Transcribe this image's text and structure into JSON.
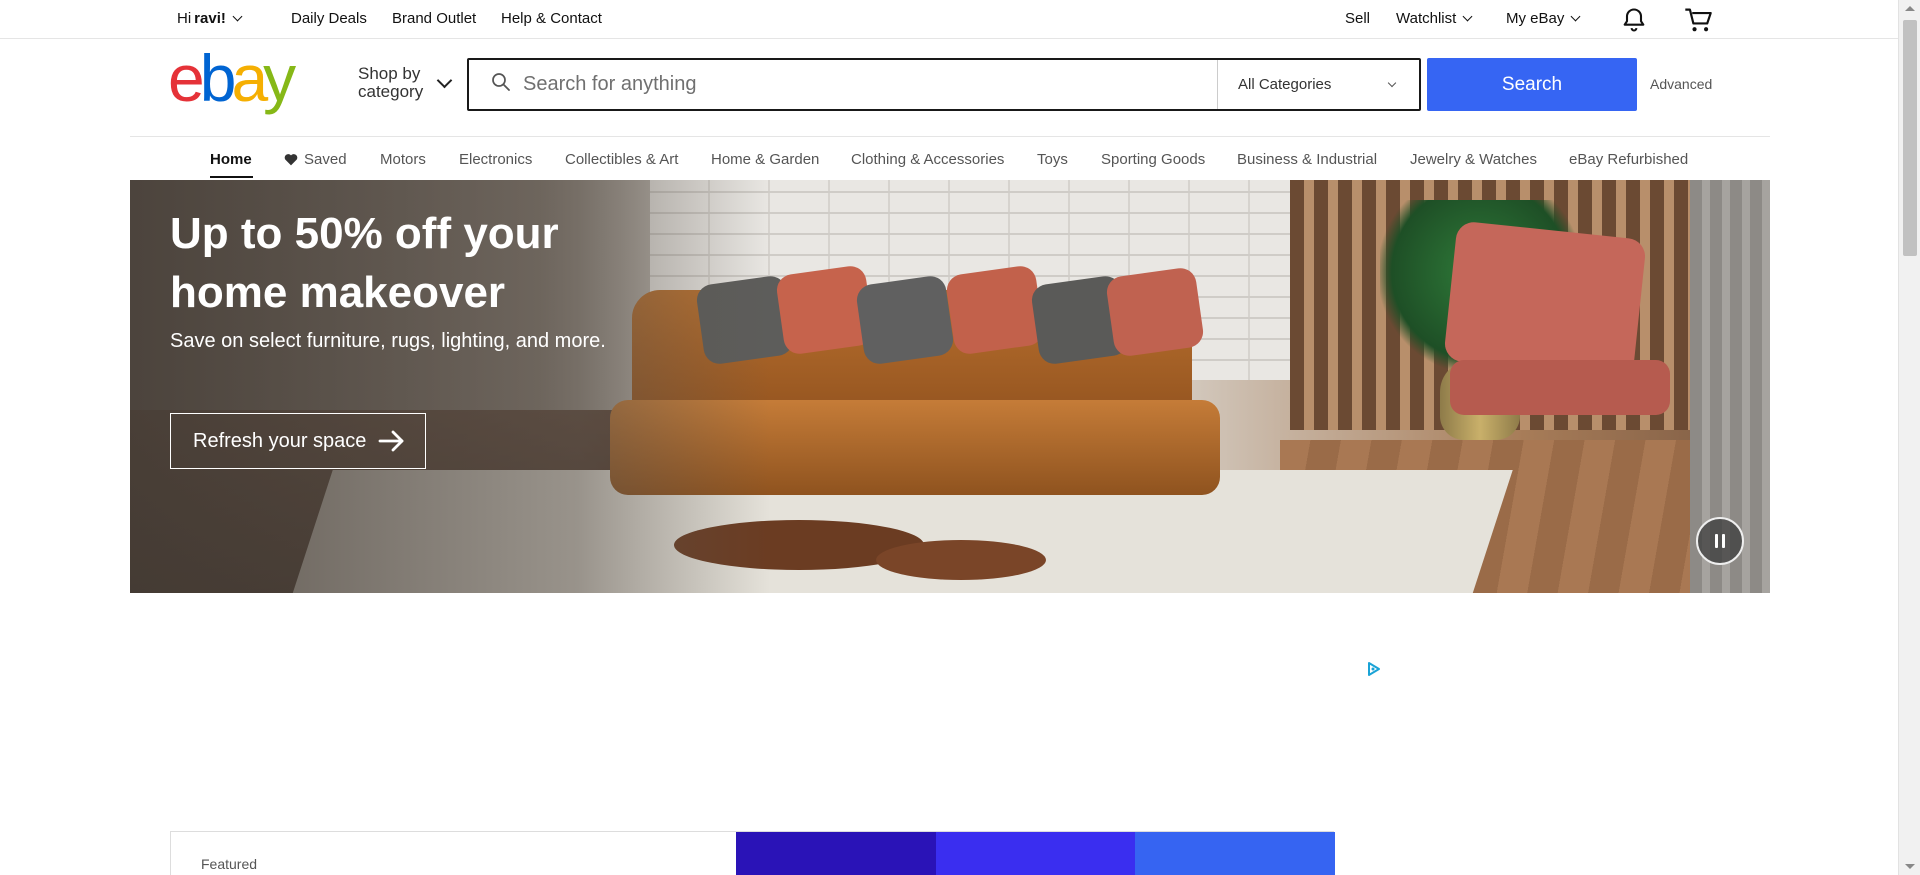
{
  "topbar": {
    "greeting_prefix": "Hi",
    "greeting_name": "ravi!",
    "links": [
      "Daily Deals",
      "Brand Outlet",
      "Help & Contact"
    ],
    "sell": "Sell",
    "watchlist": "Watchlist",
    "my_ebay": "My eBay",
    "icons": [
      "bell-icon",
      "cart-icon"
    ]
  },
  "header": {
    "logo_letters": [
      "e",
      "b",
      "a",
      "y"
    ],
    "logo_colors": [
      "#e53238",
      "#0064d2",
      "#f5af02",
      "#86b817"
    ],
    "shop_by_line1": "Shop by",
    "shop_by_line2": "category",
    "search_placeholder": "Search for anything",
    "category_select": "All Categories",
    "search_button": "Search",
    "advanced": "Advanced",
    "accent_color": "#3665f3"
  },
  "nav": {
    "items": [
      "Home",
      "Saved",
      "Motors",
      "Electronics",
      "Collectibles & Art",
      "Home & Garden",
      "Clothing & Accessories",
      "Toys",
      "Sporting Goods",
      "Business & Industrial",
      "Jewelry & Watches",
      "eBay Refurbished"
    ],
    "active": "Home"
  },
  "hero": {
    "title": "Up to 50% off your home makeover",
    "subtitle": "Save on select furniture, rugs, lighting, and more.",
    "cta": "Refresh your space"
  },
  "featured": {
    "label": "Featured",
    "colors": [
      "#2a13b7",
      "#3a2ef0",
      "#3664f2"
    ]
  }
}
